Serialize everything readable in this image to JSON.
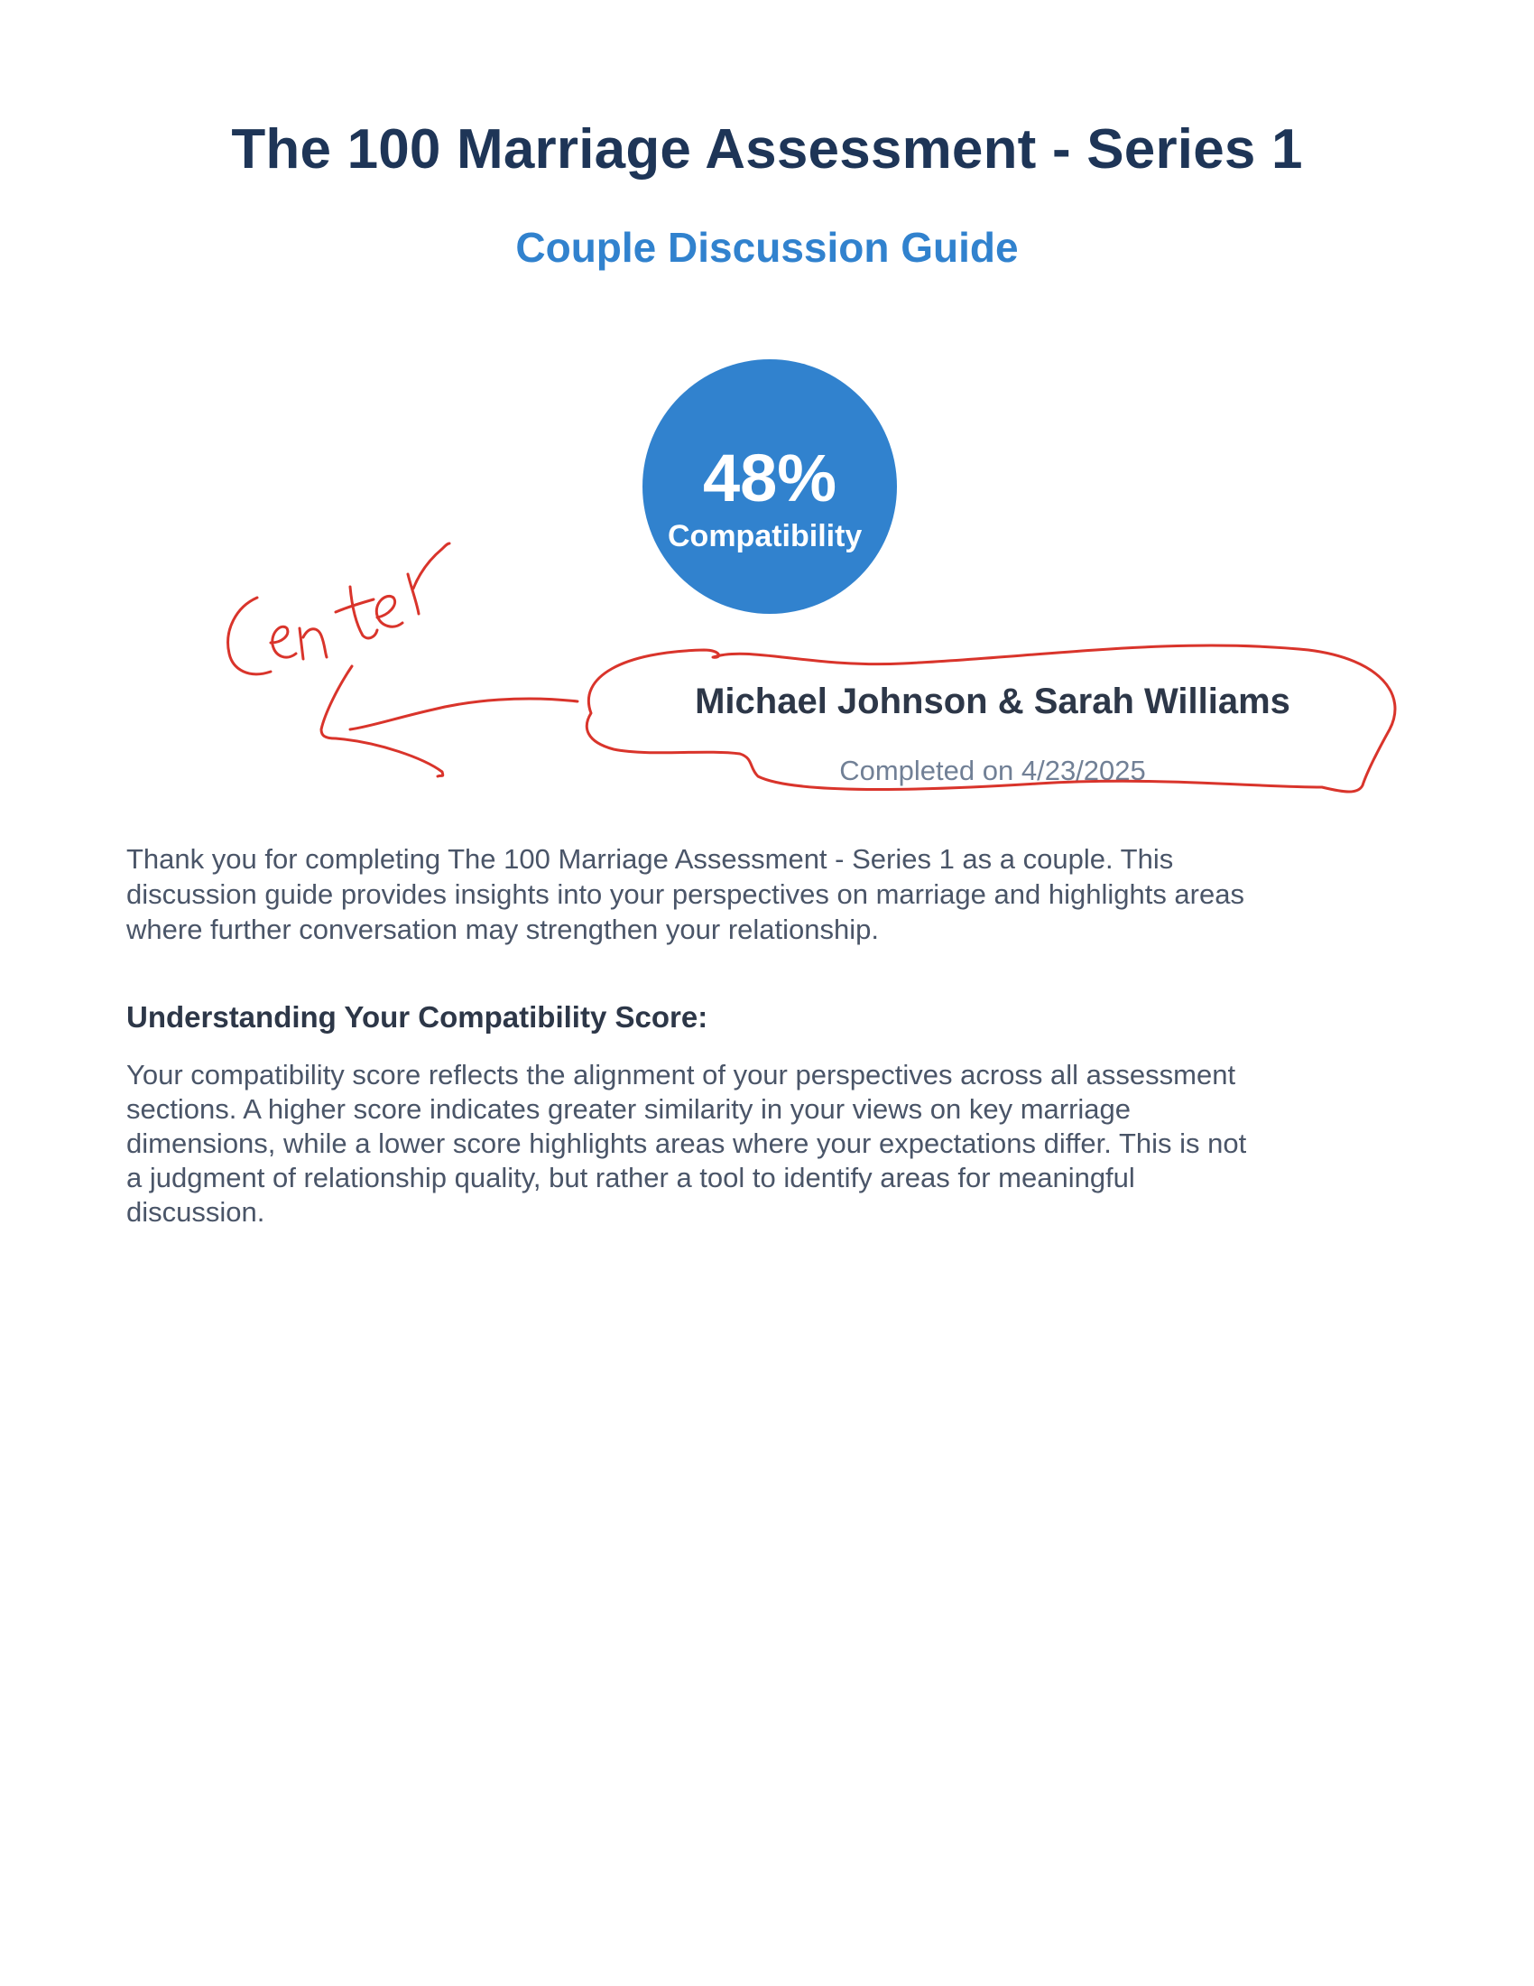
{
  "document": {
    "title": "The 100 Marriage Assessment - Series 1",
    "subtitle": "Couple Discussion Guide"
  },
  "score": {
    "value": "48%",
    "label": "Compatibility",
    "percent": 48,
    "circle_color": "#3182ce"
  },
  "couple": {
    "names": "Michael Johnson & Sarah Williams",
    "completed_prefix": "Completed on",
    "completed_date": "4/23/2025"
  },
  "intro": {
    "text": "Thank you for completing The 100 Marriage Assessment - Series 1 as a couple. This discussion guide provides insights into your perspectives on marriage and highlights areas where further conversation may strengthen your relationship."
  },
  "understanding": {
    "heading": "Understanding Your Compatibility Score:",
    "body": "Your compatibility score reflects the alignment of your perspectives across all assessment sections. A higher score indicates greater similarity in your views on key marriage dimensions, while a lower score highlights areas where your expectations differ. This is not a judgment of relationship quality, but rather a tool to identify areas for meaningful discussion."
  },
  "annotations": {
    "handwritten_text": "Center",
    "ink_color": "#d9342b"
  },
  "colors": {
    "title": "#1e3557",
    "accent": "#3182ce",
    "body_text": "#4a5568",
    "muted_text": "#718096"
  }
}
